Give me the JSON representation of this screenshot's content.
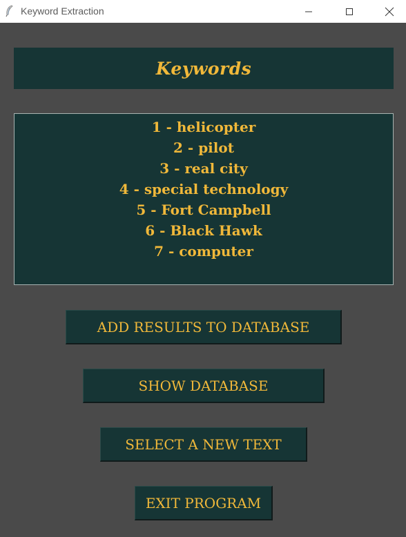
{
  "window": {
    "title": "Keyword Extraction",
    "icon": "feather-icon",
    "controls": [
      "minimize-icon",
      "maximize-icon",
      "close-icon"
    ]
  },
  "header": {
    "title": "Keywords"
  },
  "keywords": [
    "1 - helicopter",
    "2 - pilot",
    "3 - real city",
    "4 - special technology",
    "5 - Fort Campbell",
    "6 - Black Hawk",
    "7 - computer"
  ],
  "buttons": {
    "add_results": "ADD RESULTS TO DATABASE",
    "show_database": "SHOW DATABASE",
    "select_new_text": "SELECT A NEW TEXT",
    "exit_program": "EXIT PROGRAM"
  },
  "colors": {
    "background": "#4a4a4a",
    "panel": "#163535",
    "accent_text": "#f0b83a",
    "titlebar": "#ffffff"
  }
}
